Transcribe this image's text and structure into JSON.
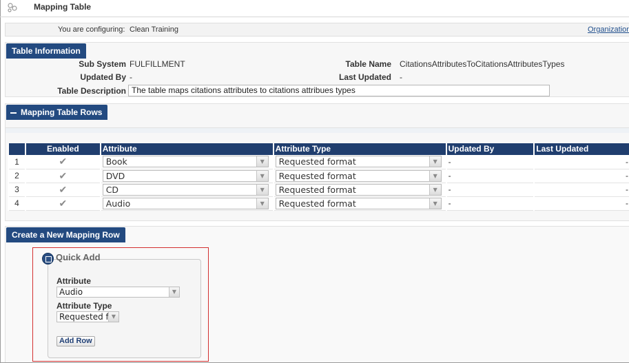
{
  "header": {
    "title": "Mapping Table",
    "icon": "mapping-table-icon"
  },
  "config": {
    "label": "You are configuring:",
    "value": "Clean Training",
    "link": "Organization"
  },
  "table_info": {
    "section_title": "Table Information",
    "sub_system_label": "Sub System",
    "sub_system_value": "FULFILLMENT",
    "table_name_label": "Table Name",
    "table_name_value": "CitationsAttributesToCitationsAttributesTypes",
    "updated_by_label": "Updated By",
    "updated_by_value": "-",
    "last_updated_label": "Last Updated",
    "last_updated_value": "-",
    "description_label": "Table Description",
    "description_value": "The table maps citations attributes to citations attribues types"
  },
  "rows_section": {
    "title": "Mapping Table Rows",
    "collapse_icon": "minus-icon",
    "columns": [
      "",
      "Enabled",
      "Attribute",
      "Attribute Type",
      "Updated By",
      "Last Updated"
    ],
    "rows": [
      {
        "num": "1",
        "attribute": "Book",
        "attribute_type": "Requested format",
        "updated_by": "-",
        "last_updated": "-"
      },
      {
        "num": "2",
        "attribute": "DVD",
        "attribute_type": "Requested format",
        "updated_by": "-",
        "last_updated": "-"
      },
      {
        "num": "3",
        "attribute": "CD",
        "attribute_type": "Requested format",
        "updated_by": "-",
        "last_updated": "-"
      },
      {
        "num": "4",
        "attribute": "Audio",
        "attribute_type": "Requested format",
        "updated_by": "-",
        "last_updated": "-"
      }
    ]
  },
  "create_section": {
    "title": "Create a New Mapping Row",
    "quick_add": {
      "title": "Quick Add",
      "attribute_label": "Attribute",
      "attribute_value": "Audio",
      "attribute_type_label": "Attribute Type",
      "attribute_type_value": "Requested format",
      "add_button": "Add Row"
    }
  },
  "colors": {
    "header_blue": "#234a80",
    "highlight_red": "#d32f2f"
  }
}
